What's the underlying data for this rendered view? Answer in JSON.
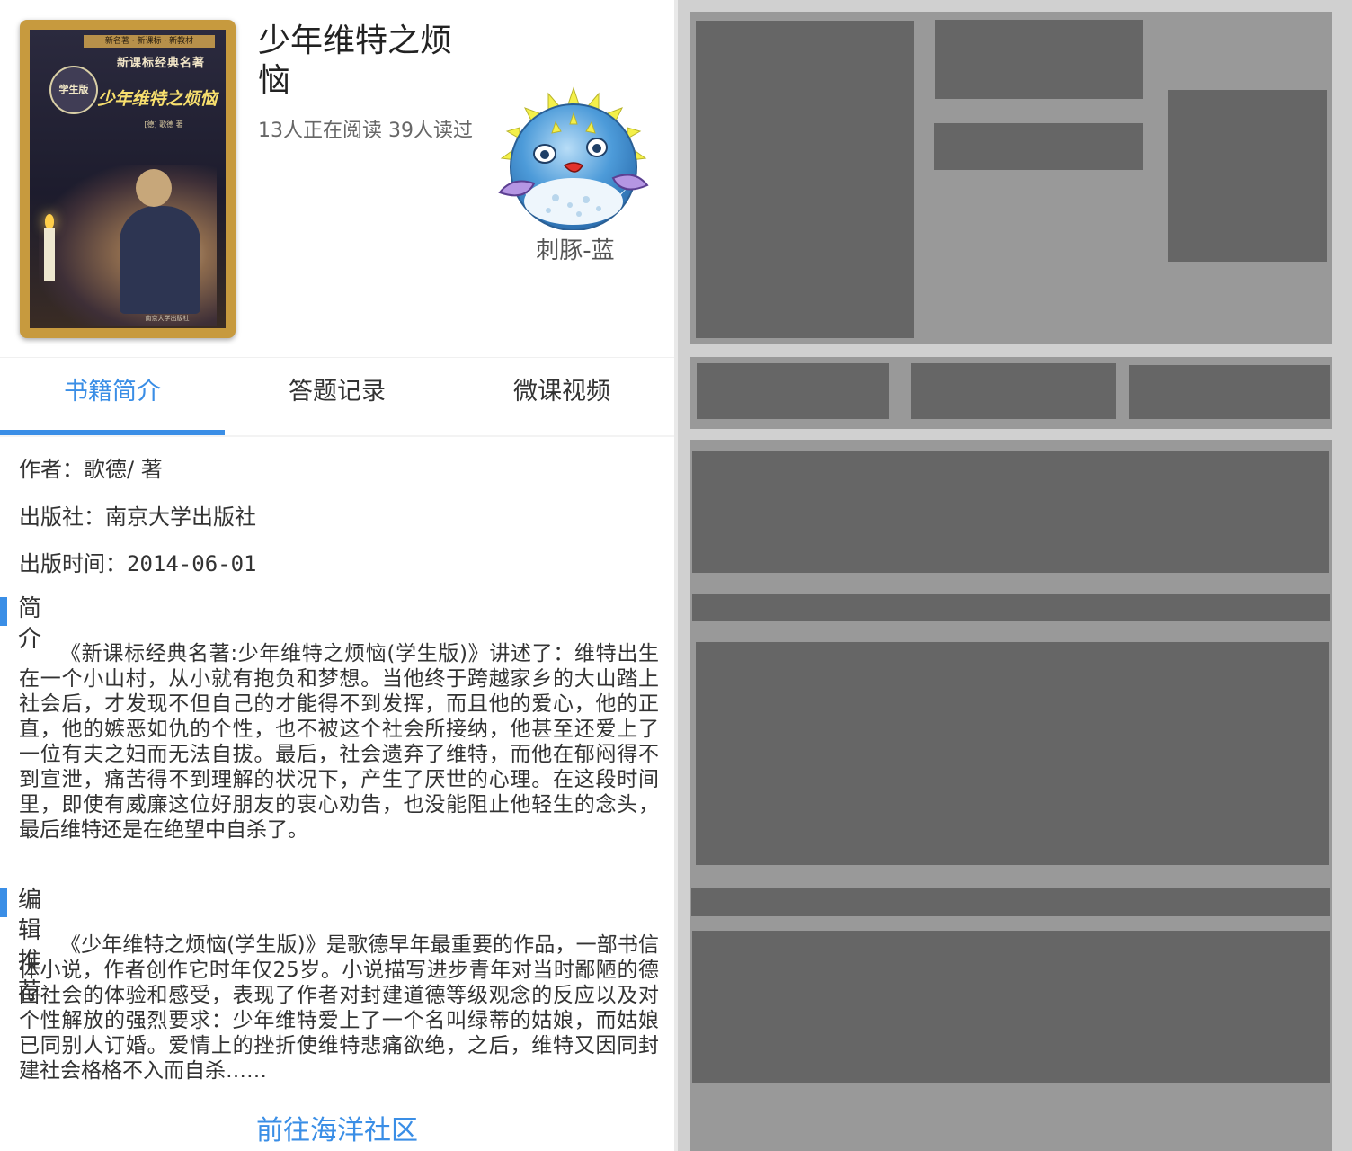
{
  "book": {
    "title": "少年维特之烦恼",
    "readers": "13人正在阅读 39人读过",
    "cover": {
      "series_band": "新名著 · 新课标 · 新教材",
      "series": "新课标经典名著",
      "badge": "学生版",
      "title": "少年维特之烦恼",
      "author": "[德] 歌德 著",
      "publisher": "南京大学出版社"
    }
  },
  "avatar": {
    "name": "刺豚-蓝",
    "icon": "pufferfish-icon"
  },
  "tabs": [
    {
      "label": "书籍简介",
      "active": true
    },
    {
      "label": "答题记录",
      "active": false
    },
    {
      "label": "微课视频",
      "active": false
    }
  ],
  "meta": {
    "author_label": "作者：",
    "author_value": "歌德/ 著",
    "publisher_label": "出版社：",
    "publisher_value": "南京大学出版社",
    "date_label": "出版时间：",
    "date_value": "2014-06-01"
  },
  "intro": {
    "heading": "简介",
    "text": "《新课标经典名著:少年维特之烦恼(学生版)》讲述了：维特出生在一个小山村，从小就有抱负和梦想。当他终于跨越家乡的大山踏上社会后，才发现不但自己的才能得不到发挥，而且他的爱心，他的正直，他的嫉恶如仇的个性，也不被这个社会所接纳，他甚至还爱上了一位有夫之妇而无法自拔。最后，社会遗弃了维特，而他在郁闷得不到宣泄，痛苦得不到理解的状况下，产生了厌世的心理。在这段时间里，即使有威廉这位好朋友的衷心劝告，也没能阻止他轻生的念头，最后维特还是在绝望中自杀了。"
  },
  "recommend": {
    "heading": "编辑推荐",
    "text": "《少年维特之烦恼(学生版)》是歌德早年最重要的作品，一部书信体小说，作者创作它时年仅25岁。小说描写进步青年对当时鄙陋的德国社会的体验和感受，表现了作者对封建道德等级观念的反应以及对个性解放的强烈要求：少年维特爱上了一个名叫绿蒂的姑娘，而姑娘已同别人订婚。爱情上的挫折使维特悲痛欲绝，之后，维特又因同封建社会格格不入而自杀……"
  },
  "footer": {
    "community_link": "前往海洋社区"
  },
  "colors": {
    "accent": "#3a8ee6",
    "placeholder_light": "#999999",
    "placeholder_dark": "#666666",
    "placeholder_bg": "#d0d0d0"
  }
}
